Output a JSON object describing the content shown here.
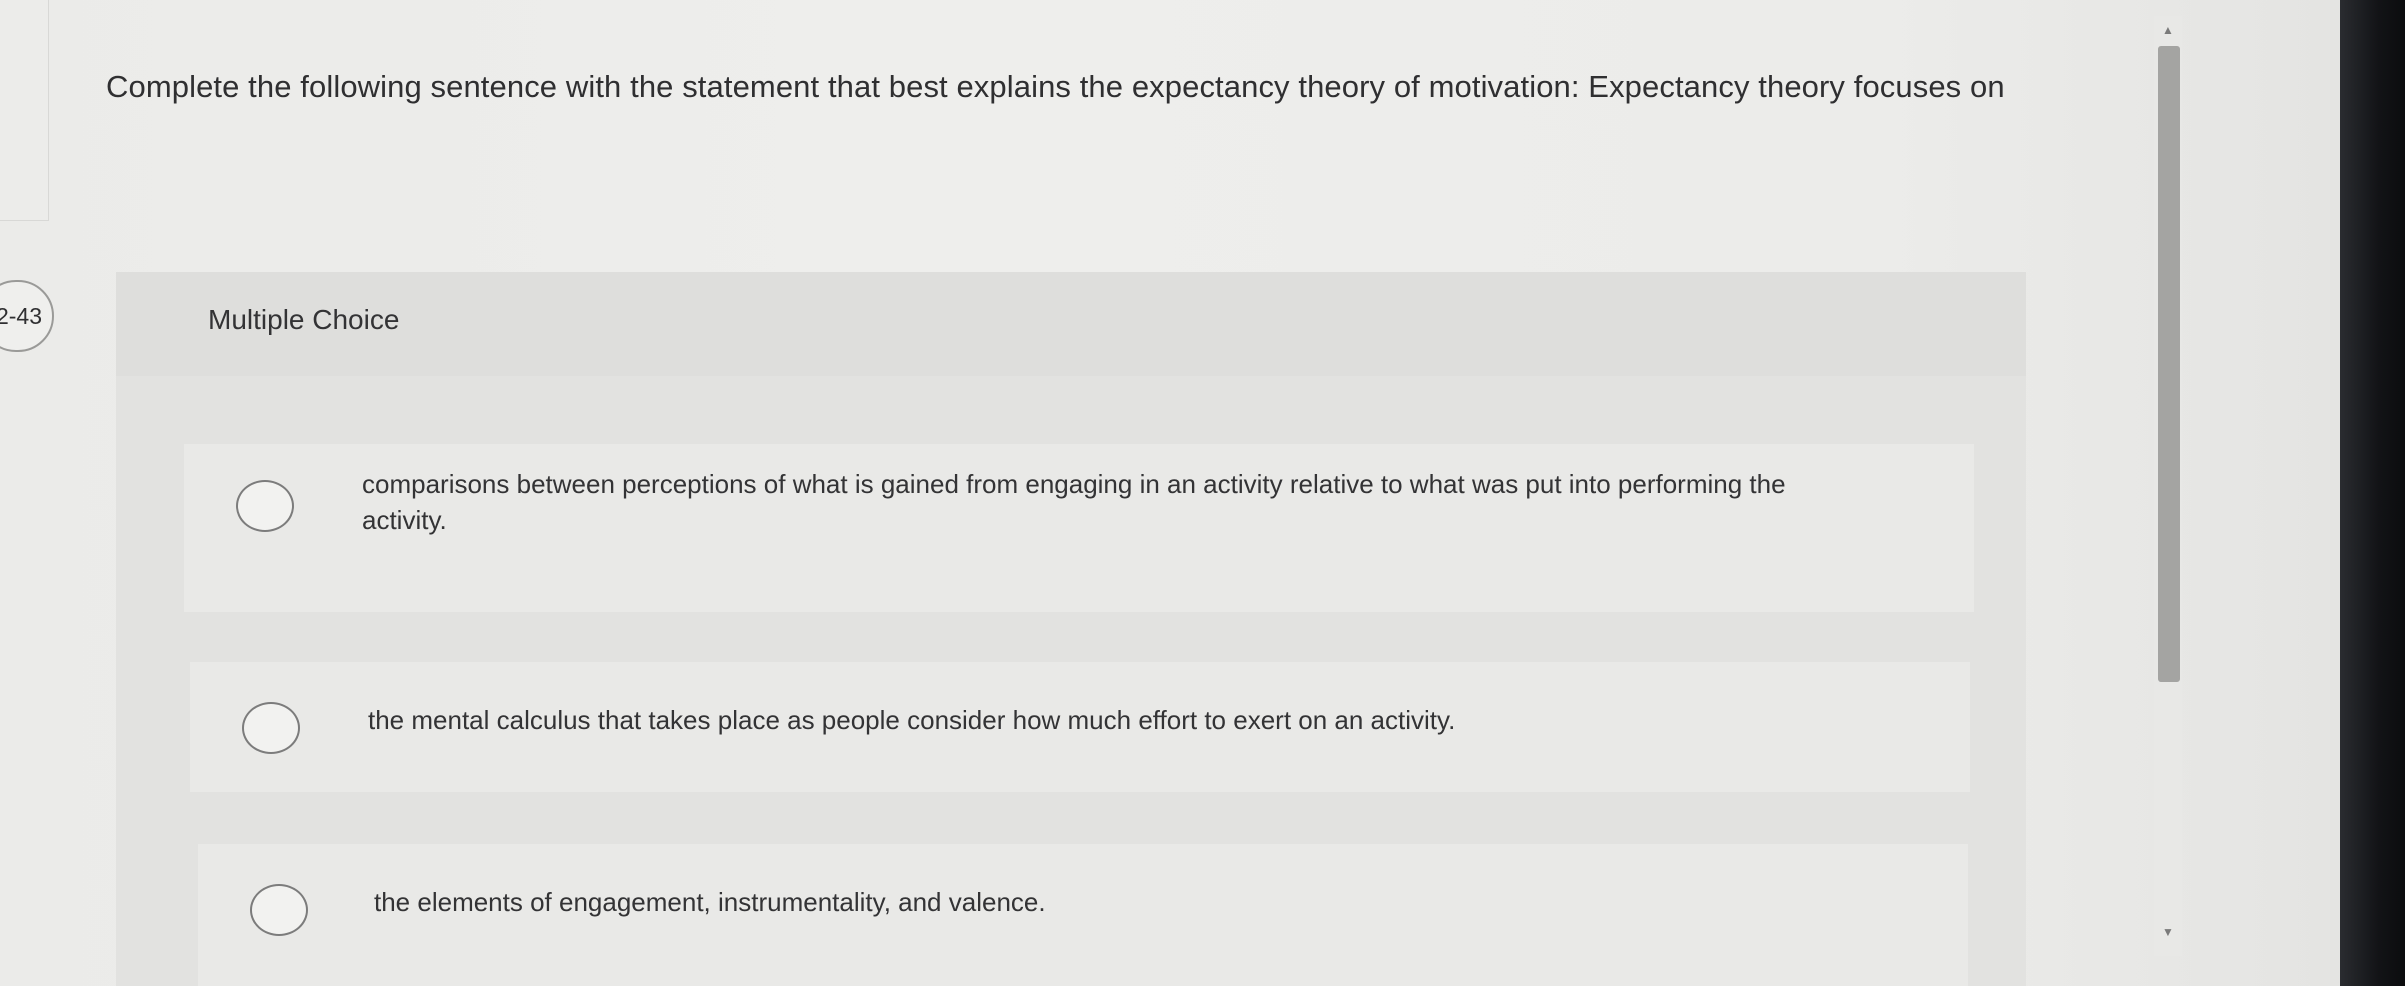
{
  "question": {
    "text": "Complete the following sentence with the statement that best explains the expectancy theory of motivation: Expectancy theory focuses on",
    "number_badge": "2-43"
  },
  "multiple_choice": {
    "label": "Multiple Choice",
    "options": [
      {
        "text": "comparisons between perceptions of what is gained from engaging in an activity relative to what was put into performing the activity."
      },
      {
        "text": "the mental calculus that takes place as people consider how much effort to exert on an activity."
      },
      {
        "text": "the elements of engagement, instrumentality, and valence."
      }
    ]
  },
  "scrollbar": {
    "up_icon": "triangle-up",
    "down_icon": "triangle-down"
  },
  "colors": {
    "page_bg": "#ececea",
    "panel_bg": "#e2e2e0",
    "option_bg": "#e9e9e7",
    "text": "#2f2f31",
    "scroll_thumb": "#a4a4a2"
  }
}
